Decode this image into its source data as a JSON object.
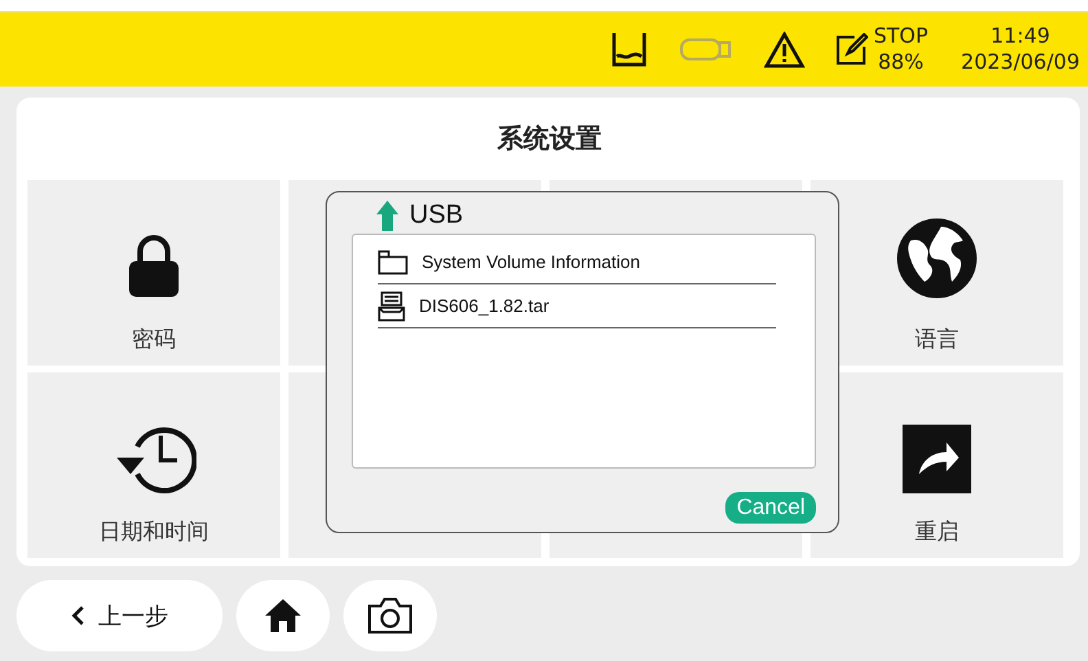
{
  "status_bar": {
    "status": "STOP",
    "percent": "88%",
    "time": "11:49",
    "date": "2023/06/09"
  },
  "title": "系统设置",
  "tiles": [
    {
      "kind": "lock",
      "label": "密码"
    },
    {
      "kind": "covered"
    },
    {
      "kind": "covered"
    },
    {
      "kind": "globe",
      "label": "语言"
    },
    {
      "kind": "history",
      "label": "日期和时间"
    },
    {
      "kind": "covered"
    },
    {
      "kind": "covered"
    },
    {
      "kind": "restart",
      "label": "重启"
    }
  ],
  "dialog": {
    "title": "USB",
    "files": [
      {
        "kind": "folder",
        "name": "System Volume Information"
      },
      {
        "kind": "archive",
        "name": "DIS606_1.82.tar"
      }
    ],
    "cancel": "Cancel"
  },
  "nav": {
    "back": "上一步"
  }
}
